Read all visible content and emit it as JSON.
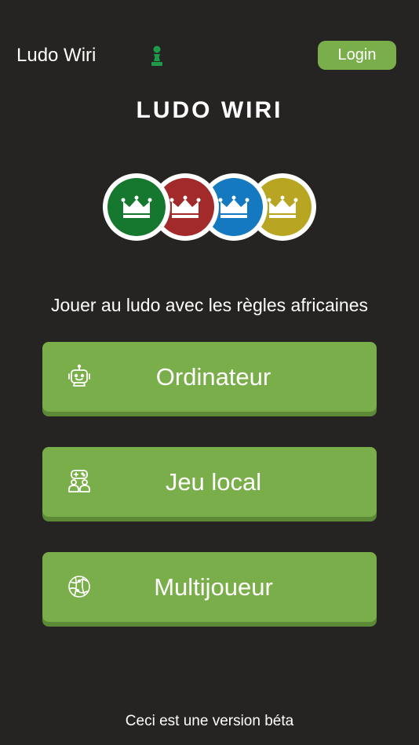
{
  "header": {
    "app_title": "Ludo Wiri",
    "login_label": "Login"
  },
  "hero": {
    "title": "LUDO WIRI",
    "tokens": [
      {
        "color": "#16782f",
        "icon": "crown-icon"
      },
      {
        "color": "#a22a2a",
        "icon": "crown-icon"
      },
      {
        "color": "#1479c1",
        "icon": "crown-icon"
      },
      {
        "color": "#b8a522",
        "icon": "crown-icon"
      }
    ]
  },
  "tagline": "Jouer au ludo avec les règles africaines",
  "modes": [
    {
      "label": "Ordinateur",
      "icon": "robot-icon"
    },
    {
      "label": "Jeu local",
      "icon": "gamepad-players-icon"
    },
    {
      "label": "Multijoueur",
      "icon": "globe-icon"
    }
  ],
  "footer": {
    "note": "Ceci est une version béta"
  },
  "colors": {
    "background": "#252422",
    "accent_green": "#7aae4a",
    "pawn_green": "#1f9a4a"
  }
}
